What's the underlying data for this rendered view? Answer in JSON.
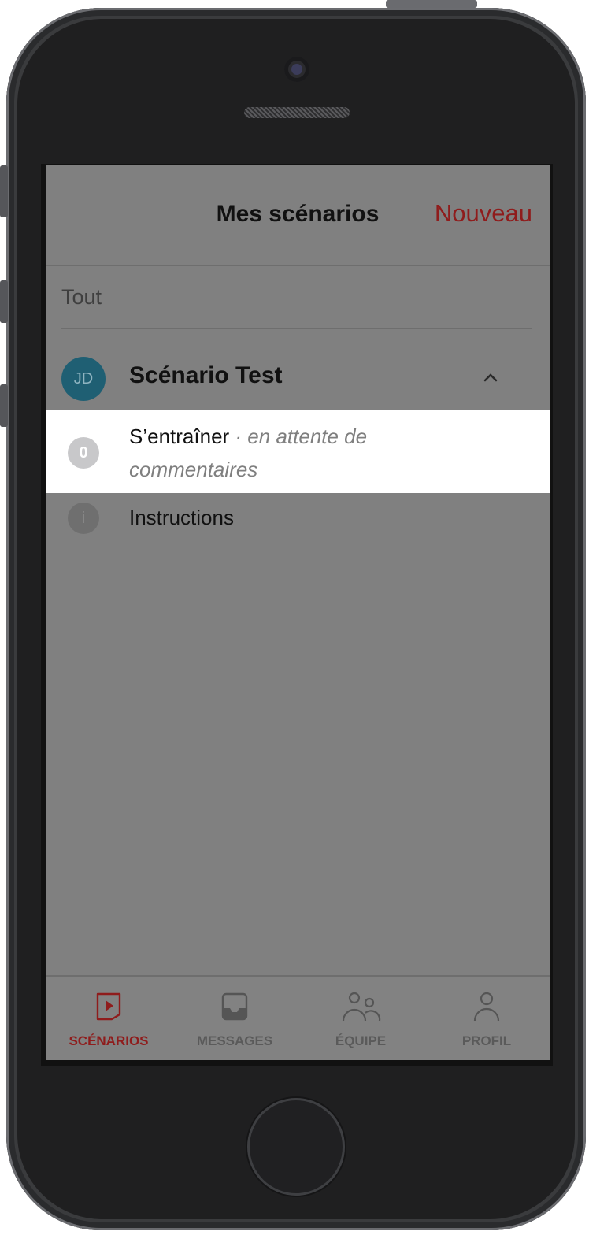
{
  "header": {
    "title": "Mes scénarios",
    "new_label": "Nouveau"
  },
  "filter": {
    "label": "Tout"
  },
  "group": {
    "avatar_initials": "JD",
    "title": "Scénario Test"
  },
  "items": [
    {
      "badge": "0",
      "title": "S’entraîner",
      "subtitle_line1": "· en attente de",
      "subtitle_line2": "commentaires"
    },
    {
      "badge": "i",
      "title": "Instructions"
    }
  ],
  "tabs": [
    {
      "label": "SCÉNARIOS",
      "icon": "scenario-play-icon",
      "active": true
    },
    {
      "label": "MESSAGES",
      "icon": "inbox-icon",
      "active": false
    },
    {
      "label": "ÉQUIPE",
      "icon": "team-icon",
      "active": false
    },
    {
      "label": "PROFIL",
      "icon": "profile-icon",
      "active": false
    }
  ],
  "colors": {
    "accent": "#8f1c1c",
    "avatar": "#1f5f73",
    "overlay": "#808080"
  }
}
